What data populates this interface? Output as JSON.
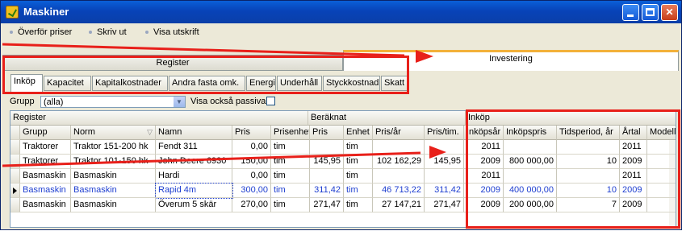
{
  "window": {
    "title": "Maskiner"
  },
  "toolbar": {
    "items": [
      "Överför priser",
      "Skriv ut",
      "Visa utskrift"
    ]
  },
  "main_tabs": {
    "register": "Register",
    "investering": "Investering"
  },
  "subtabs": [
    "Inköp",
    "Kapacitet",
    "Kapitalkostnader",
    "Andra fasta omk.",
    "Energi",
    "Underhåll",
    "Styckkostnad",
    "Skatt"
  ],
  "filter": {
    "group_label": "Grupp",
    "group_value": "(alla)",
    "passive_label": "Visa också passiva"
  },
  "grid": {
    "groups": [
      "Register",
      "Beräknat",
      "Inköp"
    ],
    "columns": [
      "Grupp",
      "Norm",
      "Namn",
      "Pris",
      "Prisenhet",
      "Pris",
      "Enhet",
      "Pris/år",
      "Pris/tim.",
      "Inköpsår",
      "Inköpspris",
      "Tidsperiod, år",
      "Årtal",
      "Modell"
    ],
    "rows": [
      [
        "Traktorer",
        "Traktor 151-200 hk",
        "Fendt 311",
        "0,00",
        "tim",
        "",
        "tim",
        "",
        "",
        "2011",
        "",
        "",
        "2011",
        ""
      ],
      [
        "Traktorer",
        "Traktor 101-150 hk",
        "John Deere 6930",
        "150,00",
        "tim",
        "145,95",
        "tim",
        "102 162,29",
        "145,95",
        "2009",
        "800 000,00",
        "10",
        "2009",
        ""
      ],
      [
        "Basmaskin",
        "Basmaskin",
        "Hardi",
        "0,00",
        "tim",
        "",
        "tim",
        "",
        "",
        "2011",
        "",
        "",
        "2011",
        ""
      ],
      [
        "Basmaskin",
        "Basmaskin",
        "Rapid 4m",
        "300,00",
        "tim",
        "311,42",
        "tim",
        "46 713,22",
        "311,42",
        "2009",
        "400 000,00",
        "10",
        "2009",
        ""
      ],
      [
        "Basmaskin",
        "Basmaskin",
        "Överum 5 skär",
        "270,00",
        "tim",
        "271,47",
        "tim",
        "27 147,21",
        "271,47",
        "2009",
        "200 000,00",
        "7",
        "2009",
        ""
      ]
    ],
    "selected_row": 3
  },
  "colors": {
    "accent": "#e8201a",
    "selected_text": "#1f3fd0",
    "titlebar": "#0843b8"
  }
}
